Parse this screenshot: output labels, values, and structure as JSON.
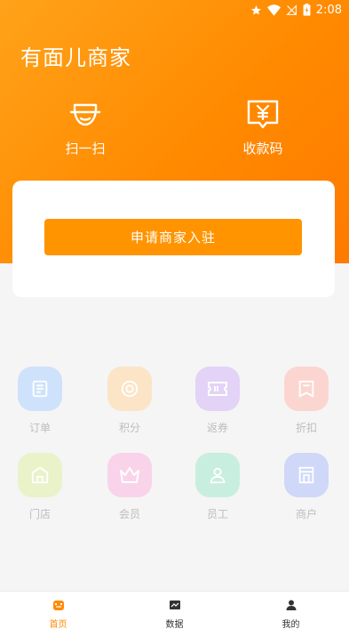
{
  "status_bar": {
    "time": "2:08"
  },
  "header": {
    "title": "有面儿商家"
  },
  "quick_actions": [
    {
      "label": "扫一扫",
      "icon": "scan-face-icon"
    },
    {
      "label": "收款码",
      "icon": "yuan-qrcode-icon"
    }
  ],
  "card": {
    "apply_button": "申请商家入驻"
  },
  "grid": [
    {
      "label": "订单",
      "icon": "order-icon",
      "color": "#cfe2fb"
    },
    {
      "label": "积分",
      "icon": "points-icon",
      "color": "#fbe5c6"
    },
    {
      "label": "返券",
      "icon": "coupon-icon",
      "color": "#e3d3f6"
    },
    {
      "label": "折扣",
      "icon": "discount-icon",
      "color": "#fbd6d1"
    },
    {
      "label": "门店",
      "icon": "store-icon",
      "color": "#eaf2c9"
    },
    {
      "label": "会员",
      "icon": "member-crown-icon",
      "color": "#f9d3ea"
    },
    {
      "label": "员工",
      "icon": "staff-icon",
      "color": "#c8eedf"
    },
    {
      "label": "商户",
      "icon": "merchant-icon",
      "color": "#cfd8f8"
    }
  ],
  "tabbar": [
    {
      "label": "首页",
      "icon": "home-icon",
      "active": true
    },
    {
      "label": "数据",
      "icon": "chart-icon",
      "active": false
    },
    {
      "label": "我的",
      "icon": "user-icon",
      "active": false
    }
  ],
  "colors": {
    "brand": "#ff8a00",
    "tab_active": "#ff8a00"
  }
}
